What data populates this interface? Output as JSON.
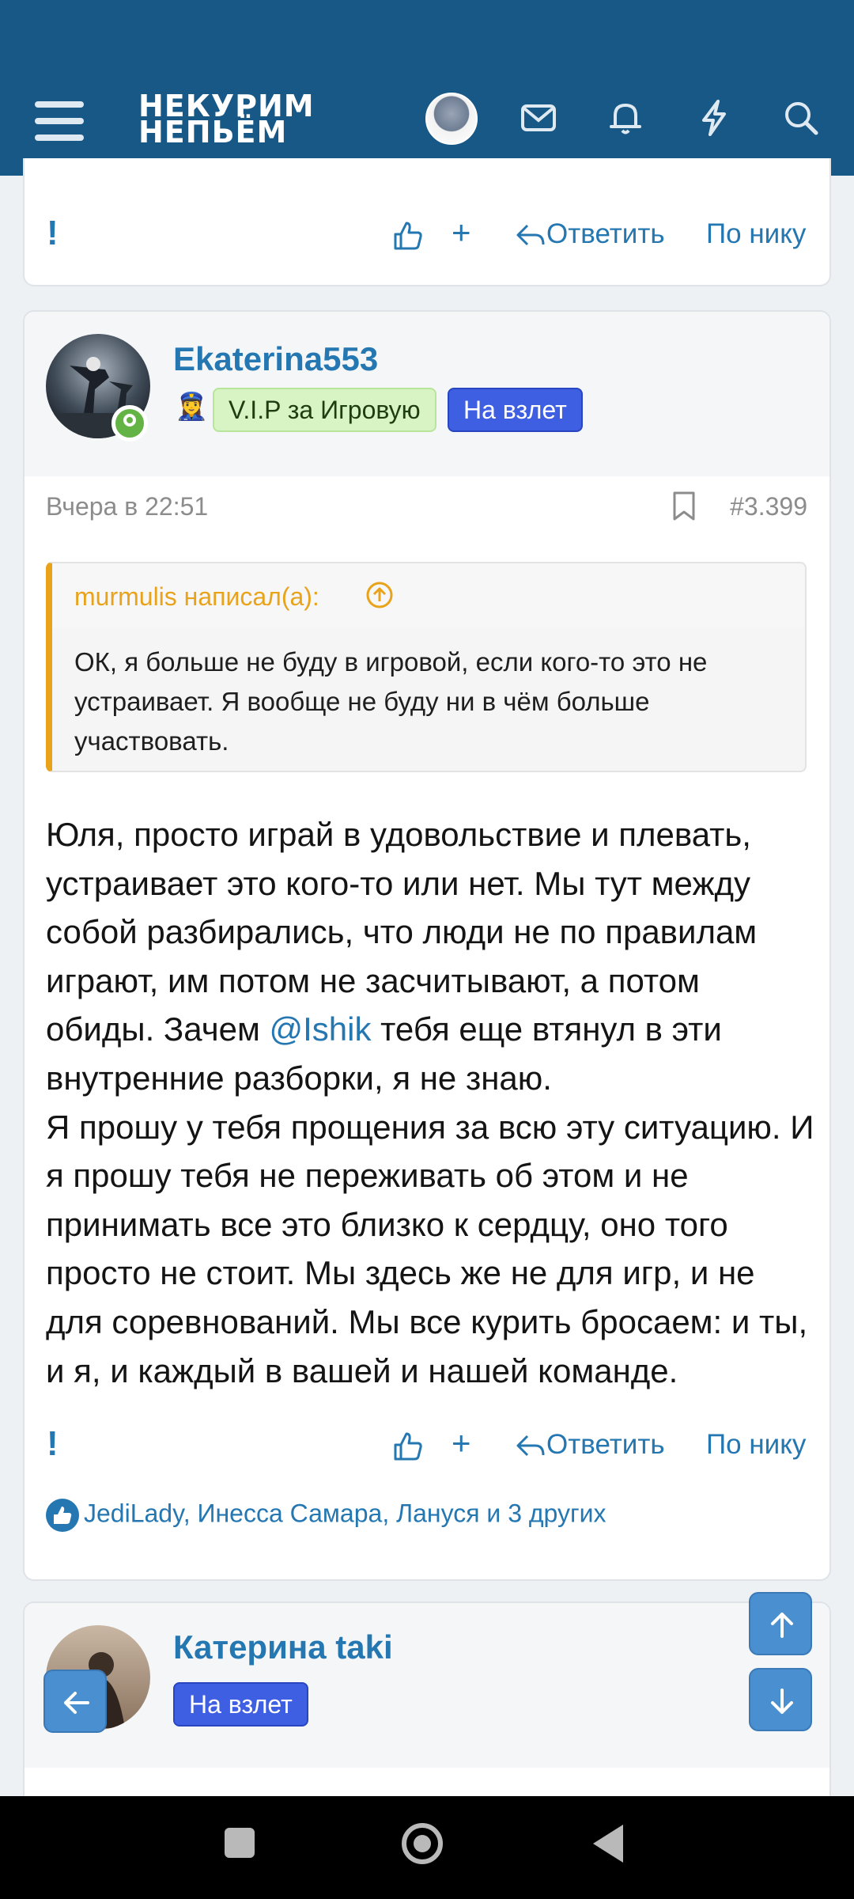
{
  "header": {
    "logo_line1": "НЕКУРИМ",
    "logo_line2": "НЕПЬЁМ",
    "icons": [
      "menu-icon",
      "envelope-icon",
      "bell-icon",
      "lightning-icon",
      "search-icon"
    ]
  },
  "actions": {
    "report": "!",
    "like_icon": "thumbs-up-icon",
    "plus": "+",
    "reply": "Ответить",
    "by_nick": "По нику"
  },
  "post": {
    "username": "Ekaterina553",
    "badge_emoji": "👮‍♀️",
    "badge_vip": "V.I.P за Игровую",
    "badge_blue": "На взлет",
    "time": "Вчера в 22:51",
    "number": "#3.399",
    "quote": {
      "author": "murmulis написал(а):",
      "text": "ОК, я больше не буду в игровой, если кого-то это не устраивает. Я вообще не буду ни в чём больше участвовать."
    },
    "body_part1": "Юля, просто играй в удовольствие и плевать, устраивает это кого-то или нет. Мы тут между собой разбирались, что люди не по правилам играют, им потом не засчитывают, а потом обиды. Зачем ",
    "mention": "@Ishik",
    "body_part2": " тебя еще втянул в эти внутренние разборки, я не знаю.",
    "body_part3": "Я прошу у тебя прощения за всю эту ситуацию. И я прошу тебя не переживать об этом и не принимать все это близко к сердцу, оно того просто не стоит. Мы здесь же не для игр, и не для соревнований. Мы все курить бросаем: и ты, и я, и каждый в вашей и нашей команде.",
    "reactions": "JediLady, Инесса Самара, Лануся и 3 других"
  },
  "next_post": {
    "username": "Катерина taki",
    "badge_blue": "На взлет"
  },
  "colors": {
    "header": "#185886",
    "link": "#2577b1",
    "quote_accent": "#e8a31b",
    "badge_blue": "#3f5fe3",
    "badge_green": "#d8f4c4"
  }
}
